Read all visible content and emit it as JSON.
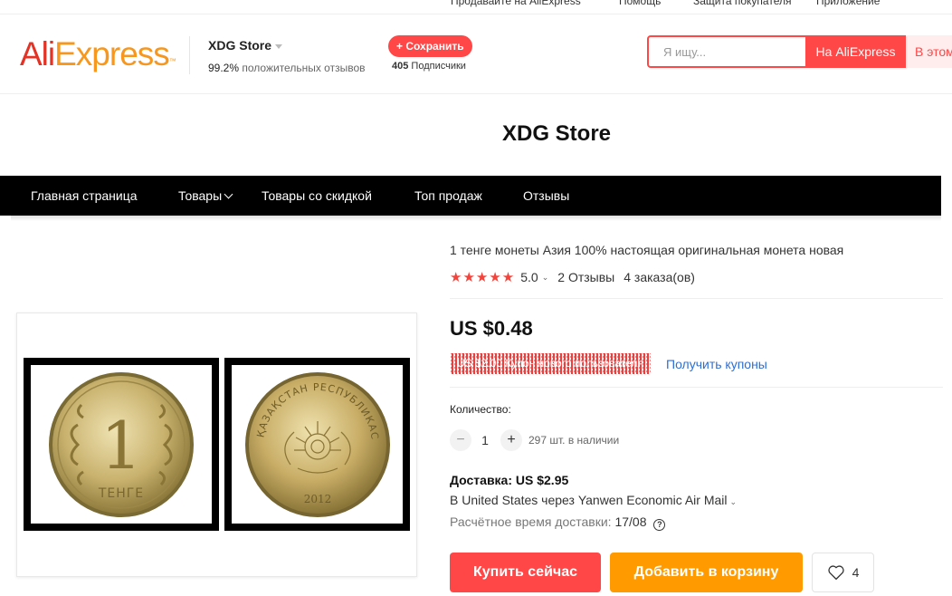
{
  "top_strip": {
    "items": [
      "Продавайте на AliExpress",
      "Помощь",
      "Защита покупателя",
      "Приложение"
    ]
  },
  "header": {
    "logo_ali": "Ali",
    "logo_express": "Express",
    "logo_mark": "™",
    "store_name": "XDG Store",
    "positive_pct": "99.2%",
    "positive_label": "положительных отзывов",
    "save_label": "+ Сохранить",
    "followers_count": "405",
    "followers_label": "Подписчики",
    "search_placeholder": "Я ищу...",
    "search_ae_label": "На AliExpress",
    "search_store_label": "В этом магазине"
  },
  "banner": {
    "title": "XDG Store"
  },
  "nav": {
    "items": [
      {
        "label": "Главная страница"
      },
      {
        "label": "Товары"
      },
      {
        "label": "Товары со скидкой"
      },
      {
        "label": "Топ продаж"
      },
      {
        "label": "Отзывы"
      }
    ]
  },
  "gallery": {
    "coin_front_label": "1",
    "coin_front_text": "ТЕНГЕ",
    "coin_back_text": "ҚАЗАҚСТАН РЕСПУБЛИКАСЫ",
    "coin_back_year": "2012"
  },
  "product": {
    "title": "1 тенге монеты Азия 100% настоящая оригинальная монета новая",
    "stars": "★★★★★",
    "rating": "5.0",
    "reviews": "2 Отзывы",
    "orders": "4 заказа(ов)",
    "price": "US $0.48",
    "coupon": "US $2.00 Купон нового пользователя",
    "get_coupons": "Получить купоны",
    "quantity_label": "Количество:",
    "quantity": "1",
    "stock": "297 шт. в наличии",
    "shipping_title": "Доставка: US $2.95",
    "shipping_method": "В United States через Yanwen Economic Air Mail",
    "eta_label": "Расчётное время доставки:",
    "eta_value": "17/08",
    "buy_now": "Купить сейчас",
    "add_to_cart": "Добавить в корзину",
    "wishlist_count": "4"
  },
  "colors": {
    "accent": "#ff4747",
    "cart": "#ff9a00",
    "link": "#2e6fd1",
    "star": "#f5433b"
  }
}
